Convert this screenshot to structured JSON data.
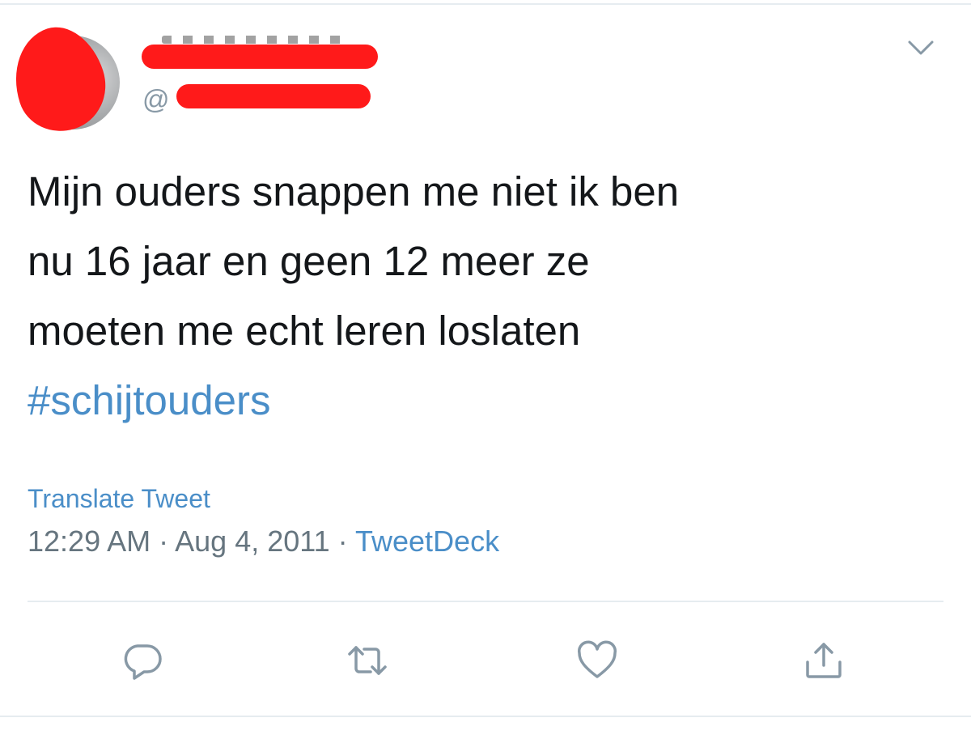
{
  "header": {
    "handle_prefix": "@",
    "menu_icon": "chevron-down-icon"
  },
  "tweet": {
    "lines": [
      "Mijn ouders snappen me niet ik ben",
      "nu 16 jaar en geen 12 meer ze",
      "moeten me echt leren loslaten"
    ],
    "hashtag": "#schijtouders",
    "translate_label": "Translate Tweet",
    "time": "12:29 AM",
    "separator": "·",
    "date": "Aug 4, 2011",
    "source": "TweetDeck"
  },
  "actions": [
    {
      "name": "reply",
      "icon": "reply-icon"
    },
    {
      "name": "retweet",
      "icon": "retweet-icon"
    },
    {
      "name": "like",
      "icon": "heart-icon"
    },
    {
      "name": "share",
      "icon": "share-icon"
    }
  ],
  "colors": {
    "redaction": "#ff1a1a",
    "link": "#4a8ec8",
    "text": "#14171a",
    "muted": "#66757f",
    "icon": "#8899a6"
  }
}
